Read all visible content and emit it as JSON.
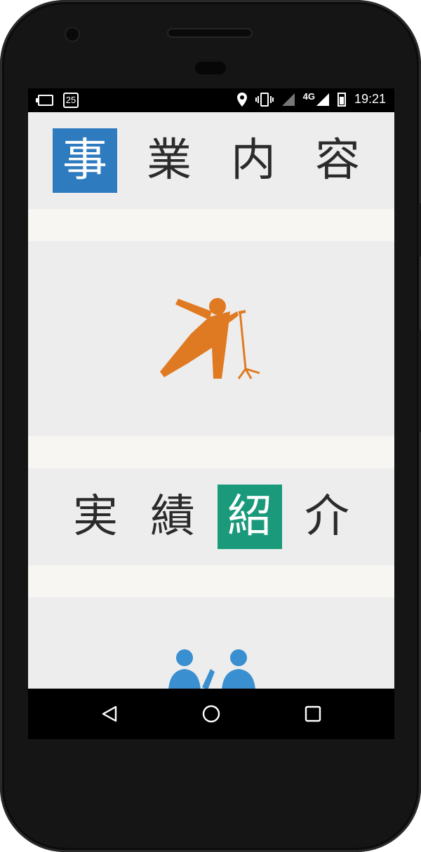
{
  "status_bar": {
    "time": "19:21",
    "network": "4G",
    "calendar_day": "25",
    "icons": [
      "battery-saver-icon",
      "calendar-icon",
      "location-icon",
      "vibrate-icon",
      "signal-icon",
      "battery-icon"
    ]
  },
  "sections": [
    {
      "title_chars": [
        "事",
        "業",
        "内",
        "容"
      ],
      "highlight_index": 0,
      "highlight_color": "#2e7bbf"
    },
    {
      "illustration": "singer-icon",
      "color": "#e07a22"
    },
    {
      "title_chars": [
        "実",
        "績",
        "紹",
        "介"
      ],
      "highlight_index": 2,
      "highlight_color": "#1a9a7a"
    },
    {
      "illustration": "people-icon",
      "color": "#3a8fd0"
    }
  ],
  "nav": {
    "buttons": [
      "back-icon",
      "home-icon",
      "recents-icon"
    ]
  }
}
